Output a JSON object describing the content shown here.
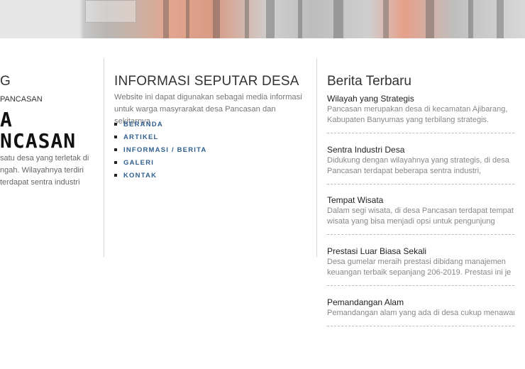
{
  "left_column": {
    "title_fragment": "G",
    "subtitle_fragment": "PANCASAN",
    "big_line1": "A",
    "big_line2": "NCASAN",
    "text_lines": [
      "satu desa yang terletak di",
      "ngah. Wilayahnya terdiri",
      "terdapat sentra industri"
    ]
  },
  "middle_column": {
    "title": "INFORMASI SEPUTAR DESA",
    "description": "Website ini dapat digunakan sebagai media informasi untuk warga masyrarakat desa Pancasan dan sekitarnya",
    "menu": [
      "BERANDA",
      "ARTIKEL",
      "INFORMASI / BERITA",
      "GALERI",
      "KONTAK"
    ]
  },
  "right_column": {
    "title": "Berita Terbaru",
    "news": [
      {
        "title": "Wilayah yang Strategis",
        "lines": [
          "Pancasan merupakan desa di kecamatan Ajibarang,",
          "Kabupaten Banyumas yang terbilang strategis."
        ]
      },
      {
        "title": "Sentra Industri Desa",
        "lines": [
          "Didukung dengan wilayahnya yang strategis, di desa",
          "Pancasan terdapat beberapa sentra industri,"
        ]
      },
      {
        "title": "Tempat Wisata",
        "lines": [
          "Dalam segi wisata, di desa Pancasan terdapat tempat",
          "wisata yang bisa menjadi opsi untuk pengunjung"
        ]
      },
      {
        "title": "Prestasi Luar Biasa Sekali",
        "lines": [
          "Desa gumelar meraih prestasi dibidang manajemen",
          "keuangan terbaik sepanjang 206-2019. Prestasi ini je"
        ]
      },
      {
        "title": "Pemandangan Alam",
        "lines": [
          "Pemandangan alam yang ada di desa cukup menawan"
        ]
      }
    ]
  }
}
